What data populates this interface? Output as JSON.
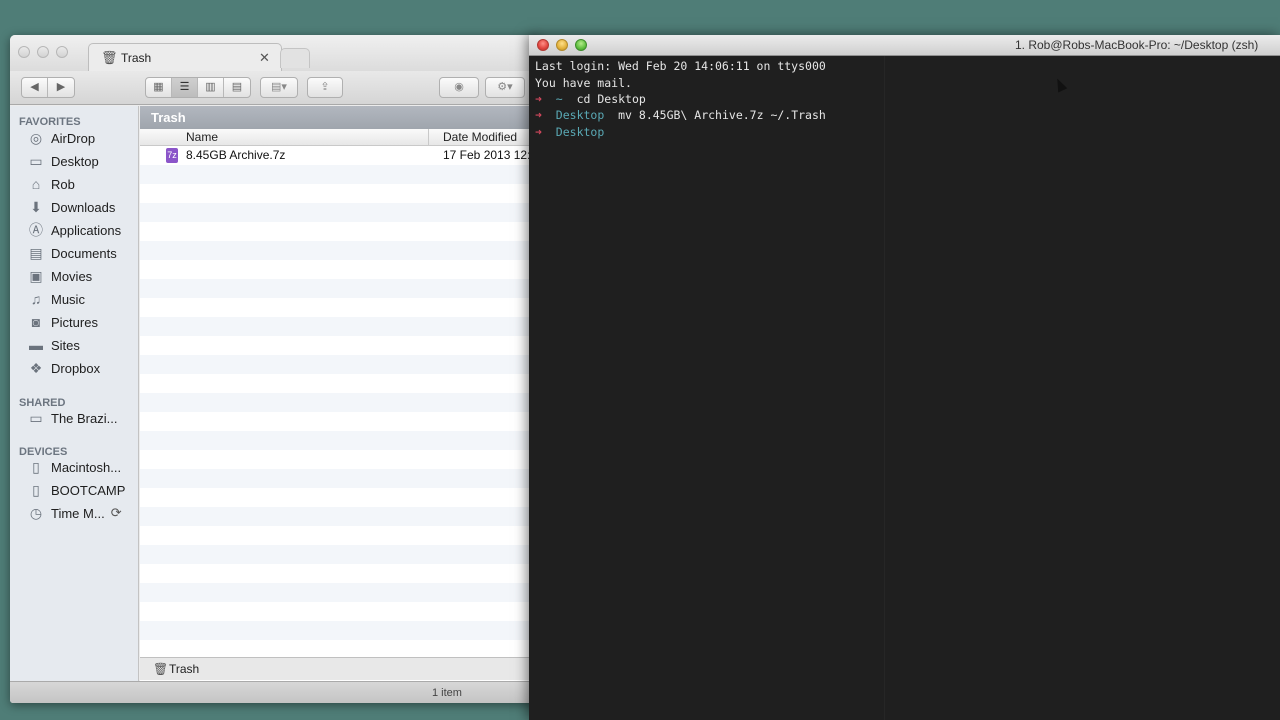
{
  "finder": {
    "tab_title": "Trash",
    "path_header": "Trash",
    "columns": {
      "name": "Name",
      "date": "Date Modified"
    },
    "sidebar": {
      "favorites_header": "FAVORITES",
      "favorites": [
        {
          "label": "AirDrop",
          "icon": "airdrop-icon"
        },
        {
          "label": "Desktop",
          "icon": "desktop-icon"
        },
        {
          "label": "Rob",
          "icon": "home-icon"
        },
        {
          "label": "Downloads",
          "icon": "downloads-icon"
        },
        {
          "label": "Applications",
          "icon": "applications-icon"
        },
        {
          "label": "Documents",
          "icon": "documents-icon"
        },
        {
          "label": "Movies",
          "icon": "movies-icon"
        },
        {
          "label": "Music",
          "icon": "music-icon"
        },
        {
          "label": "Pictures",
          "icon": "pictures-icon"
        },
        {
          "label": "Sites",
          "icon": "folder-icon"
        },
        {
          "label": "Dropbox",
          "icon": "dropbox-icon"
        }
      ],
      "shared_header": "SHARED",
      "shared": [
        {
          "label": "The Brazi...",
          "icon": "network-computer-icon"
        }
      ],
      "devices_header": "DEVICES",
      "devices": [
        {
          "label": "Macintosh...",
          "icon": "drive-icon"
        },
        {
          "label": "BOOTCAMP",
          "icon": "drive-icon"
        },
        {
          "label": "Time M...",
          "icon": "time-machine-icon"
        }
      ]
    },
    "files": [
      {
        "name": "8.45GB Archive.7z",
        "date": "17 Feb 2013 12:"
      }
    ],
    "pathbar": "Trash",
    "status": "1 item"
  },
  "terminal": {
    "title": "1. Rob@Robs-MacBook-Pro: ~/Desktop (zsh)",
    "lines": {
      "login": "Last login: Wed Feb 20 14:06:11 on ttys000",
      "mail": "You have mail.",
      "l3_prompt": "➜",
      "l3_dir": "~",
      "l3_cmd": "cd Desktop",
      "l4_prompt": "➜",
      "l4_dir": "Desktop",
      "l4_cmd": "mv 8.45GB\\ Archive.7z ~/.Trash",
      "l5_prompt": "➜",
      "l5_dir": "Desktop"
    }
  },
  "colors": {
    "desktop_bg": "#4f7d77",
    "prompt_arrow": "#d2485d",
    "prompt_dir": "#5aa9b5",
    "archive_icon": "#8b55c9"
  }
}
